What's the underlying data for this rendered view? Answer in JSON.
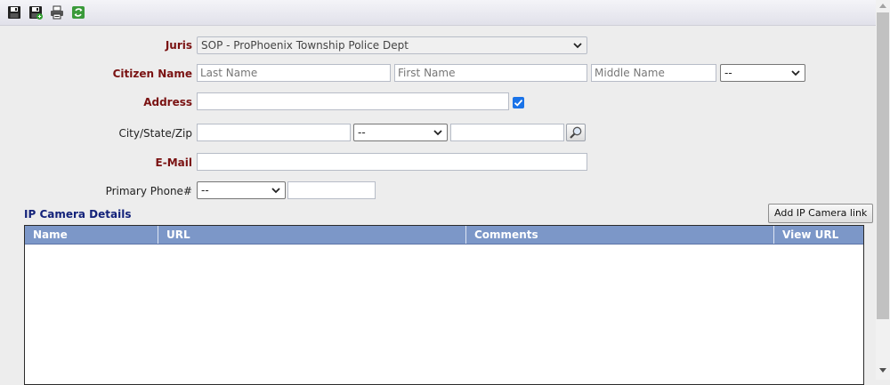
{
  "toolbar": {
    "buttons": [
      {
        "icon": "save-icon"
      },
      {
        "icon": "save-and-new-icon"
      },
      {
        "icon": "print-icon"
      },
      {
        "icon": "refresh-icon"
      }
    ]
  },
  "form": {
    "juris": {
      "label": "Juris",
      "value": "SOP - ProPhoenix Township Police Dept"
    },
    "citizen_name": {
      "label": "Citizen Name",
      "last_placeholder": "Last Name",
      "first_placeholder": "First Name",
      "middle_placeholder": "Middle Name",
      "suffix_value": "--"
    },
    "address": {
      "label": "Address",
      "value": "",
      "checkbox_checked": true
    },
    "city_state_zip": {
      "label": "City/State/Zip",
      "city_value": "",
      "state_value": "--",
      "zip_value": ""
    },
    "email": {
      "label": "E-Mail",
      "value": ""
    },
    "primary_phone": {
      "label": "Primary Phone#",
      "type_value": "--",
      "number_value": ""
    }
  },
  "ip_camera": {
    "title": "IP Camera Details",
    "add_button_label": "Add IP Camera link",
    "columns": [
      "Name",
      "URL",
      "Comments",
      "View URL"
    ],
    "rows": []
  },
  "colors": {
    "required_label": "#7a1212",
    "section_title": "#14237a",
    "grid_header": "#7c97c8",
    "checkbox": "#1a73e8"
  }
}
